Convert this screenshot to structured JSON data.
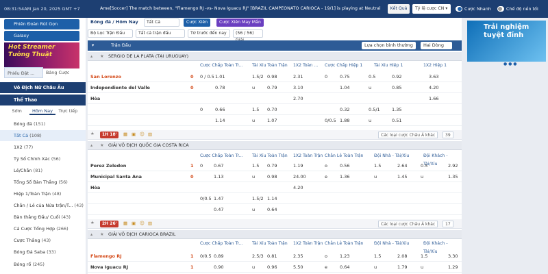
{
  "header": {
    "time": "08:31:54AM Jan 20, 2025 GMT +7",
    "ticker": "Ame[Soccer] The match between, \"Flamengo RJ -vs- Nova Iguacu RJ\" [BRAZIL CAMPEONATO CARIOCA - 19/1] is playing at Neutral",
    "btn_out": "Kết Quả",
    "odds_type": "Tỷ lệ cược CN",
    "quick_bet": "Cược Nhanh",
    "single_mode": "Chế độ nền tối"
  },
  "sidebar": {
    "promo1": "Phiên Đoàn Rút Gọn",
    "promo2": "Galaxy",
    "banner": "Hot Streamer Tưởng Thuật",
    "tab1": "Phiếu Đặt ...",
    "tab2": "Bảng Cược",
    "sec1": "Vô Địch Nữ Châu Âu",
    "sec2": "Thể Thao",
    "sub1": "Sớm",
    "sub2": "Hôm Nay",
    "sub3": "Trực tiếp",
    "items": [
      {
        "label": "Bóng đá",
        "count": "(151)"
      },
      {
        "label": "Tất Cả",
        "count": "(108)"
      },
      {
        "label": "1X2",
        "count": "(77)"
      },
      {
        "label": "Tỷ Số Chính Xác",
        "count": "(56)"
      },
      {
        "label": "Lẻ/Chẵn",
        "count": "(81)"
      },
      {
        "label": "Tổng Số Bàn Thắng",
        "count": "(56)"
      },
      {
        "label": "Hiệp 1/Toàn Trận",
        "count": "(48)"
      },
      {
        "label": "Chẵn / Lẻ của Nửa trận/T...",
        "count": "(43)"
      },
      {
        "label": "Bàn thắng Đầu/ Cuối",
        "count": "(43)"
      },
      {
        "label": "Cá Cược Tổng Hợp",
        "count": "(266)"
      },
      {
        "label": "Cược Thắng",
        "count": "(43)"
      },
      {
        "label": "Bóng Đá Saba",
        "count": "(33)"
      },
      {
        "label": "Bóng rổ",
        "count": "(245)"
      }
    ]
  },
  "main": {
    "breadcrumb": "Bóng đá / Hôm Nay",
    "filter_all": "Tất Cả",
    "btn_parlay": "Cược Xiên",
    "btn_parlay_lucky": "Cược Xiên May Mắn",
    "f1": "Bộ Lọc Trận Đấu",
    "f2": "Tất cả trận đấu",
    "f3": "Từ trước đến nay",
    "f4": "(56 / 56) Giải",
    "match_label": "Trận Đấu",
    "sort": "Lựa chọn bình thường",
    "view": "Hai Dòng",
    "league1": "SERGIO DE LA PLATA (TẠI URUGUAY)",
    "league2": "GIẢI VÔ ĐỊCH QUỐC GIA COSTA RICA",
    "league3": "GIẢI VÔ ĐỊCH CARIOCA BRAZIL",
    "hdr1": [
      "Cược Chấp Toàn Tr...",
      "Tài Xỉu Toàn Trận",
      "1X2 Toàn ...",
      "Cược Chấp Hiệp 1",
      "Tài Xỉu Hiệp 1",
      "1X2 Hiệp 1"
    ],
    "hdr2": [
      "Cược Chấp Toàn Tr...",
      "Tài Xỉu Toàn Trận",
      "1X2 Toàn Trận",
      "Chẵn Lẻ Toàn Trận",
      "Đội Nhà - Tài/Xỉu",
      "Đội Khách - Tài/Xỉu"
    ],
    "m1": {
      "home": "San Lorenzo",
      "away": "Independiente del Valle",
      "draw": "Hòa",
      "hs": "0",
      "as": "0",
      "live": "1H 18'",
      "other": "Các loại cược Châu Á khác",
      "num": "39"
    },
    "m2": {
      "home": "Perez Zeledon",
      "away": "Municipal Santa Ana",
      "draw": "Hòa",
      "hs": "1",
      "as": "0",
      "live": "2H 26'",
      "other": "Các loại cược Châu Á khác",
      "num": "17"
    },
    "m3": {
      "home": "Flamengo RJ",
      "away": "Nova Iguacu RJ",
      "hs": "1",
      "as": "1"
    }
  },
  "r1": [
    [
      "0 / 0.5",
      "1.01",
      "1.5/2",
      "0.98",
      "2.31",
      "0",
      "0.75",
      "0.5",
      "0.92",
      "3.63"
    ],
    [
      "",
      "0.78",
      "u",
      "0.79",
      "3.10",
      "",
      "1.04",
      "u",
      "0.85",
      "4.20"
    ],
    [
      "",
      "",
      "",
      "",
      "2.70",
      "",
      "",
      "",
      "",
      "1.66"
    ],
    [
      "0",
      "0.66",
      "1.5",
      "0.70",
      "",
      "",
      "0.32",
      "0.5/1",
      "1.35",
      ""
    ],
    [
      "",
      "1.14",
      "u",
      "1.07",
      "",
      "0/0.5",
      "1.88",
      "u",
      "0.51",
      ""
    ]
  ],
  "r2": [
    [
      "0",
      "0.67",
      "1.5",
      "0.79",
      "1.19",
      "o",
      "0.56",
      "1.5",
      "2.64",
      "0.5",
      "2.92"
    ],
    [
      "",
      "1.13",
      "u",
      "0.98",
      "24.00",
      "e",
      "1.36",
      "u",
      "1.45",
      "u",
      "1.35"
    ],
    [
      "",
      "",
      "",
      "",
      "4.20",
      "",
      "",
      "",
      "",
      "",
      ""
    ],
    [
      "0/0.5",
      "1.47",
      "1.5/2",
      "1.14",
      "",
      "",
      "",
      "",
      "",
      "",
      ""
    ],
    [
      "",
      "0.47",
      "u",
      "0.64",
      "",
      "",
      "",
      "",
      "",
      "",
      ""
    ]
  ],
  "r3": [
    [
      "0/0.5",
      "0.89",
      "2.5/3",
      "0.81",
      "2.35",
      "o",
      "1.23",
      "1.5",
      "2.08",
      "1.5",
      "3.30"
    ],
    [
      "",
      "0.90",
      "u",
      "0.96",
      "5.50",
      "e",
      "0.64",
      "u",
      "1.79",
      "u",
      "1.29"
    ]
  ],
  "right": {
    "ad": "Trải nghiệm tuyệt đỉnh"
  }
}
